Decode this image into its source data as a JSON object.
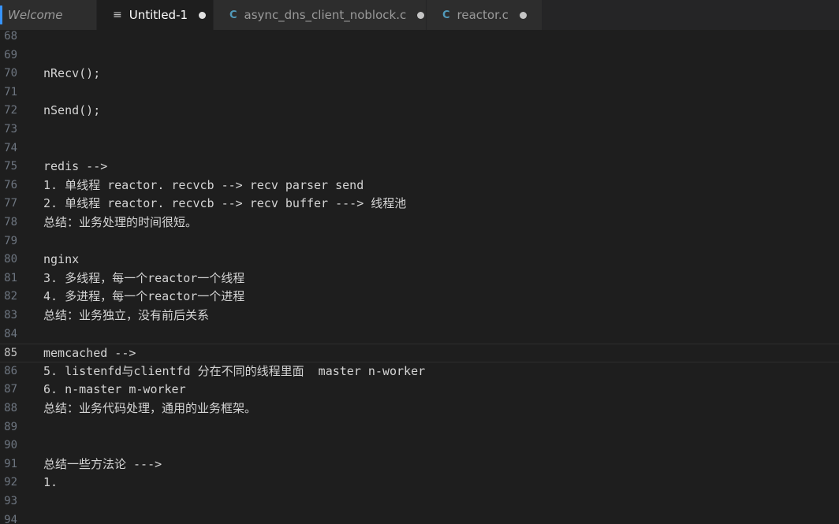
{
  "tabs": [
    {
      "label": "Welcome",
      "icon": "none",
      "active": false,
      "dirty": false
    },
    {
      "label": "Untitled-1",
      "icon": "text-file-icon",
      "active": true,
      "dirty": true
    },
    {
      "label": "async_dns_client_noblock.c",
      "icon": "c-file-icon",
      "active": false,
      "dirty": true
    },
    {
      "label": "reactor.c",
      "icon": "c-file-icon",
      "active": false,
      "dirty": true
    }
  ],
  "colors": {
    "background": "#1e1e1e",
    "tabbar": "#252526",
    "accent": "#3794ff",
    "c_icon": "#519aba"
  },
  "editor": {
    "current_line": "85",
    "lines": [
      {
        "num": "68",
        "text": ""
      },
      {
        "num": "69",
        "text": ""
      },
      {
        "num": "70",
        "text": "nRecv();"
      },
      {
        "num": "71",
        "text": ""
      },
      {
        "num": "72",
        "text": "nSend();"
      },
      {
        "num": "73",
        "text": ""
      },
      {
        "num": "74",
        "text": ""
      },
      {
        "num": "75",
        "text": "redis -->"
      },
      {
        "num": "76",
        "text": "1. 单线程 reactor. recvcb --> recv parser send"
      },
      {
        "num": "77",
        "text": "2. 单线程 reactor. recvcb --> recv buffer ---> 线程池"
      },
      {
        "num": "78",
        "text": "总结：业务处理的时间很短。"
      },
      {
        "num": "79",
        "text": ""
      },
      {
        "num": "80",
        "text": "nginx"
      },
      {
        "num": "81",
        "text": "3. 多线程，每一个reactor一个线程"
      },
      {
        "num": "82",
        "text": "4. 多进程，每一个reactor一个进程"
      },
      {
        "num": "83",
        "text": "总结：业务独立，没有前后关系"
      },
      {
        "num": "84",
        "text": ""
      },
      {
        "num": "85",
        "text": "memcached -->"
      },
      {
        "num": "86",
        "text": "5. listenfd与clientfd 分在不同的线程里面  master n-worker"
      },
      {
        "num": "87",
        "text": "6. n-master m-worker"
      },
      {
        "num": "88",
        "text": "总结：业务代码处理，通用的业务框架。"
      },
      {
        "num": "89",
        "text": ""
      },
      {
        "num": "90",
        "text": ""
      },
      {
        "num": "91",
        "text": "总结一些方法论 --->"
      },
      {
        "num": "92",
        "text": "1."
      },
      {
        "num": "93",
        "text": ""
      },
      {
        "num": "94",
        "text": ""
      }
    ]
  }
}
